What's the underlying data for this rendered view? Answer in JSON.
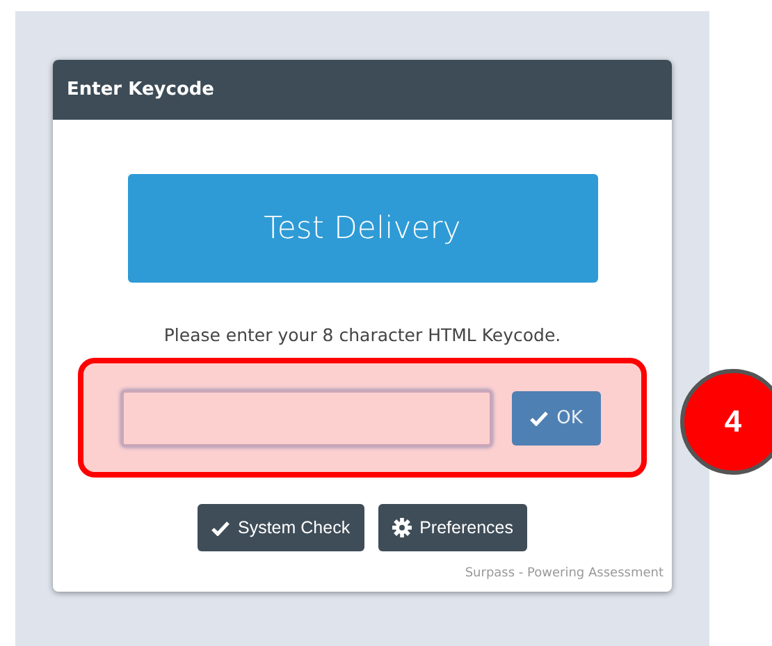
{
  "dialog": {
    "title": "Enter Keycode",
    "banner": "Test Delivery",
    "instruction": "Please enter your 8 character HTML Keycode.",
    "keycode_field": {
      "highlighted": true
    },
    "ok_button": "OK",
    "buttons": [
      {
        "label": "System Check",
        "kind": "check"
      },
      {
        "label": "Preferences",
        "kind": "gear"
      }
    ],
    "footer": "Surpass - Powering Assessment"
  },
  "callout": {
    "number": "4"
  }
}
